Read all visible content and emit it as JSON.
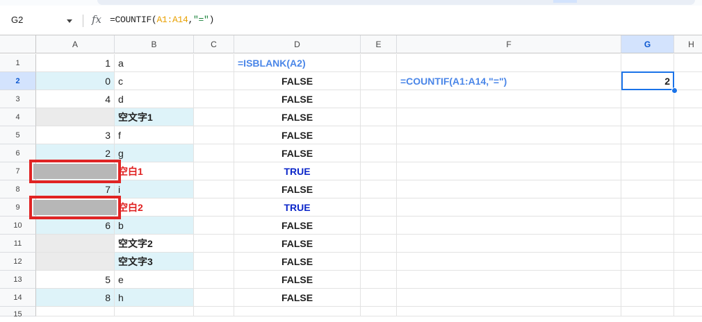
{
  "name_box": "G2",
  "formula_bar": {
    "prefix": "=COUNTIF(",
    "ref": "A1:A14",
    "comma": ",",
    "str": "\"=\"",
    "suffix": ")"
  },
  "columns": [
    "A",
    "B",
    "C",
    "D",
    "E",
    "F",
    "G",
    "H"
  ],
  "selected_column": "G",
  "selected_row": 2,
  "rows": [
    {
      "num": "1",
      "a": "1",
      "b": "a",
      "d": "=ISBLANK(A2)",
      "f": "",
      "g": ""
    },
    {
      "num": "2",
      "a": "0",
      "b": "c",
      "d": "FALSE",
      "f": "=COUNTIF(A1:A14,\"=\")",
      "g": "2"
    },
    {
      "num": "3",
      "a": "4",
      "b": "d",
      "d": "FALSE",
      "f": "",
      "g": ""
    },
    {
      "num": "4",
      "a": "",
      "b": "空文字1",
      "d": "FALSE",
      "f": "",
      "g": ""
    },
    {
      "num": "5",
      "a": "3",
      "b": "f",
      "d": "FALSE",
      "f": "",
      "g": ""
    },
    {
      "num": "6",
      "a": "2",
      "b": "g",
      "d": "FALSE",
      "f": "",
      "g": ""
    },
    {
      "num": "7",
      "a": "",
      "b": "空白1",
      "d": "TRUE",
      "f": "",
      "g": ""
    },
    {
      "num": "8",
      "a": "7",
      "b": "i",
      "d": "FALSE",
      "f": "",
      "g": ""
    },
    {
      "num": "9",
      "a": "",
      "b": "空白2",
      "d": "TRUE",
      "f": "",
      "g": ""
    },
    {
      "num": "10",
      "a": "6",
      "b": "b",
      "d": "FALSE",
      "f": "",
      "g": ""
    },
    {
      "num": "11",
      "a": "",
      "b": "空文字2",
      "d": "FALSE",
      "f": "",
      "g": ""
    },
    {
      "num": "12",
      "a": "",
      "b": "空文字3",
      "d": "FALSE",
      "f": "",
      "g": ""
    },
    {
      "num": "13",
      "a": "5",
      "b": "e",
      "d": "FALSE",
      "f": "",
      "g": ""
    },
    {
      "num": "14",
      "a": "8",
      "b": "h",
      "d": "FALSE",
      "f": "",
      "g": ""
    }
  ],
  "partial_row_num": "15",
  "colors": {
    "band": "#def3f9",
    "selection": "#1a73e8",
    "highlight_border": "#e02424",
    "formula_text": "#4a86e8",
    "true_text": "#0b26c9"
  }
}
